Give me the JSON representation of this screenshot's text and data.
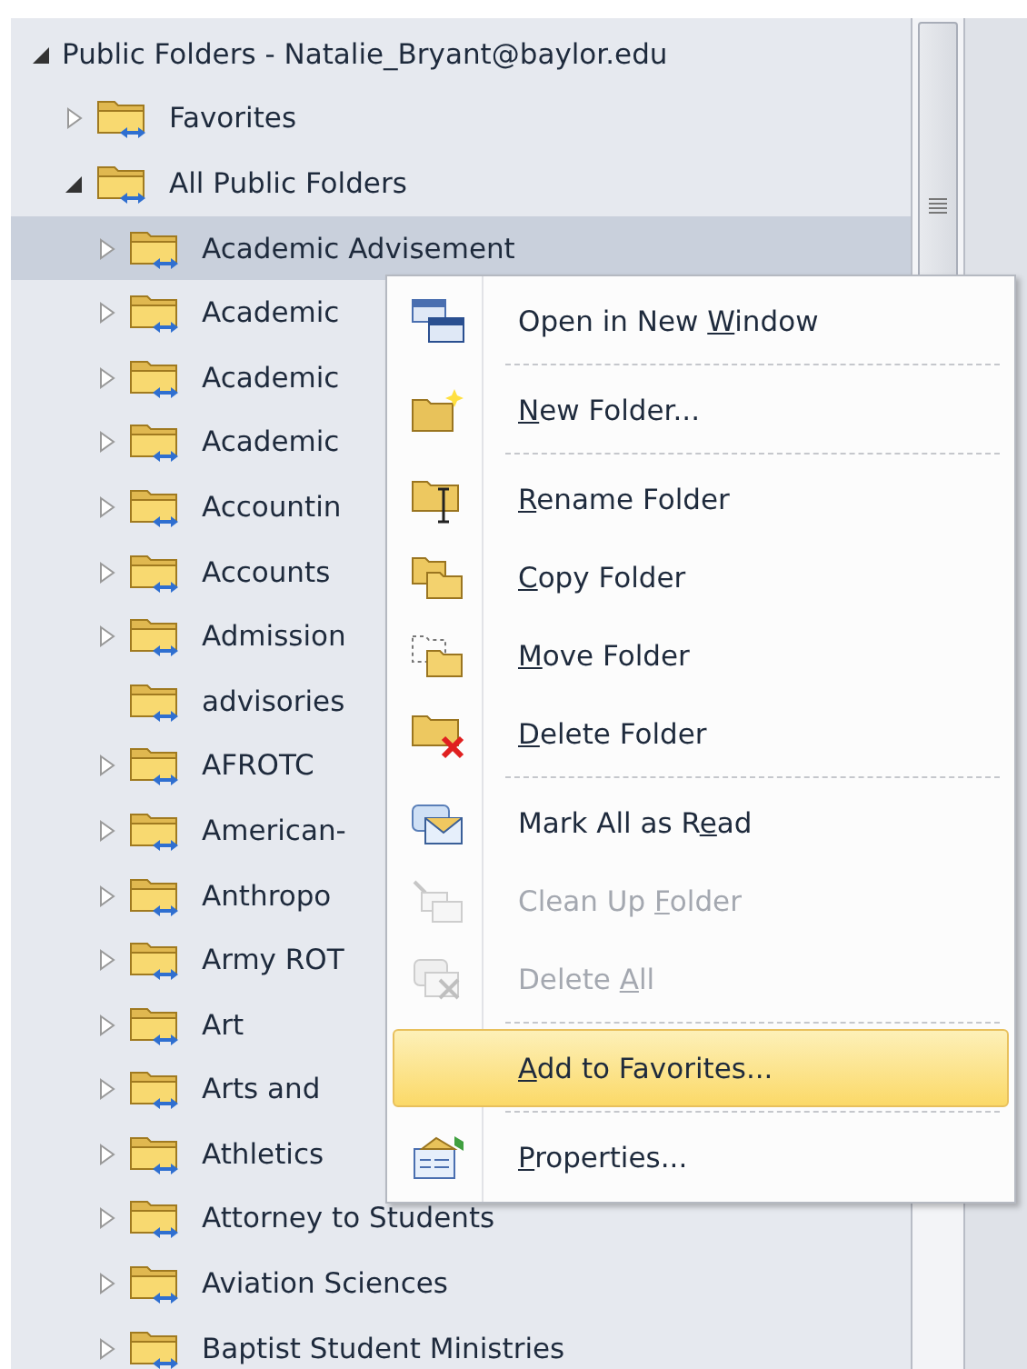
{
  "tree": {
    "label": "Public Folders - Natalie_Bryant@baylor.edu",
    "expanded": true,
    "selected": false,
    "children": [
      {
        "label": "Favorites",
        "has_children": true,
        "expanded": false,
        "selected": false
      },
      {
        "label": "All Public Folders",
        "has_children": true,
        "expanded": true,
        "selected": false,
        "children": [
          {
            "label": "Academic Advisement",
            "has_children": true,
            "expanded": false,
            "selected": true
          },
          {
            "label": "Academic",
            "has_children": true,
            "expanded": false,
            "selected": false
          },
          {
            "label": "Academic",
            "has_children": true,
            "expanded": false,
            "selected": false
          },
          {
            "label": "Academic",
            "has_children": true,
            "expanded": false,
            "selected": false
          },
          {
            "label": "Accountin",
            "has_children": true,
            "expanded": false,
            "selected": false
          },
          {
            "label": "Accounts",
            "has_children": true,
            "expanded": false,
            "selected": false
          },
          {
            "label": "Admission",
            "has_children": true,
            "expanded": false,
            "selected": false
          },
          {
            "label": "advisories",
            "selected": false
          },
          {
            "label": "AFROTC",
            "has_children": true,
            "expanded": false,
            "selected": false
          },
          {
            "label": "American-",
            "has_children": true,
            "expanded": false,
            "selected": false
          },
          {
            "label": "Anthropo",
            "has_children": true,
            "expanded": false,
            "selected": false
          },
          {
            "label": "Army ROT",
            "has_children": true,
            "expanded": false,
            "selected": false
          },
          {
            "label": "Art",
            "has_children": true,
            "expanded": false,
            "selected": false
          },
          {
            "label": "Arts and",
            "has_children": true,
            "expanded": false,
            "selected": false
          },
          {
            "label": "Athletics",
            "has_children": true,
            "expanded": false,
            "selected": false
          },
          {
            "label": "Attorney to Students",
            "has_children": true,
            "expanded": false,
            "selected": false
          },
          {
            "label": "Aviation Sciences",
            "has_children": true,
            "expanded": false,
            "selected": false
          },
          {
            "label": "Baptist Student Ministries",
            "has_children": true,
            "expanded": false,
            "selected": false
          }
        ]
      }
    ]
  },
  "context_menu": [
    {
      "kind": "item",
      "before": "Open in New ",
      "key": "W",
      "after": "indow",
      "disabled": false,
      "selected": false
    },
    {
      "kind": "separator"
    },
    {
      "kind": "item",
      "key": "N",
      "after": "ew Folder...",
      "disabled": false,
      "selected": false
    },
    {
      "kind": "separator"
    },
    {
      "kind": "item",
      "key": "R",
      "after": "ename Folder",
      "disabled": false,
      "selected": false
    },
    {
      "kind": "item",
      "key": "C",
      "after": "opy Folder",
      "disabled": false,
      "selected": false
    },
    {
      "kind": "item",
      "key": "M",
      "after": "ove Folder",
      "disabled": false,
      "selected": false
    },
    {
      "kind": "item",
      "key": "D",
      "after": "elete Folder",
      "disabled": false,
      "selected": false
    },
    {
      "kind": "separator"
    },
    {
      "kind": "item",
      "before": "Mark All as R",
      "key": "e",
      "after": "ad",
      "disabled": false,
      "selected": false
    },
    {
      "kind": "item",
      "before": "Clean Up ",
      "key": "F",
      "after": "older",
      "disabled": true,
      "selected": false
    },
    {
      "kind": "item",
      "before": "Delete ",
      "key": "A",
      "after": "ll",
      "disabled": true,
      "selected": false
    },
    {
      "kind": "separator"
    },
    {
      "kind": "item",
      "key": "A",
      "after": "dd to Favorites...",
      "disabled": false,
      "selected": true
    },
    {
      "kind": "separator"
    },
    {
      "kind": "item",
      "key": "P",
      "after": "roperties...",
      "disabled": false,
      "selected": false
    }
  ]
}
